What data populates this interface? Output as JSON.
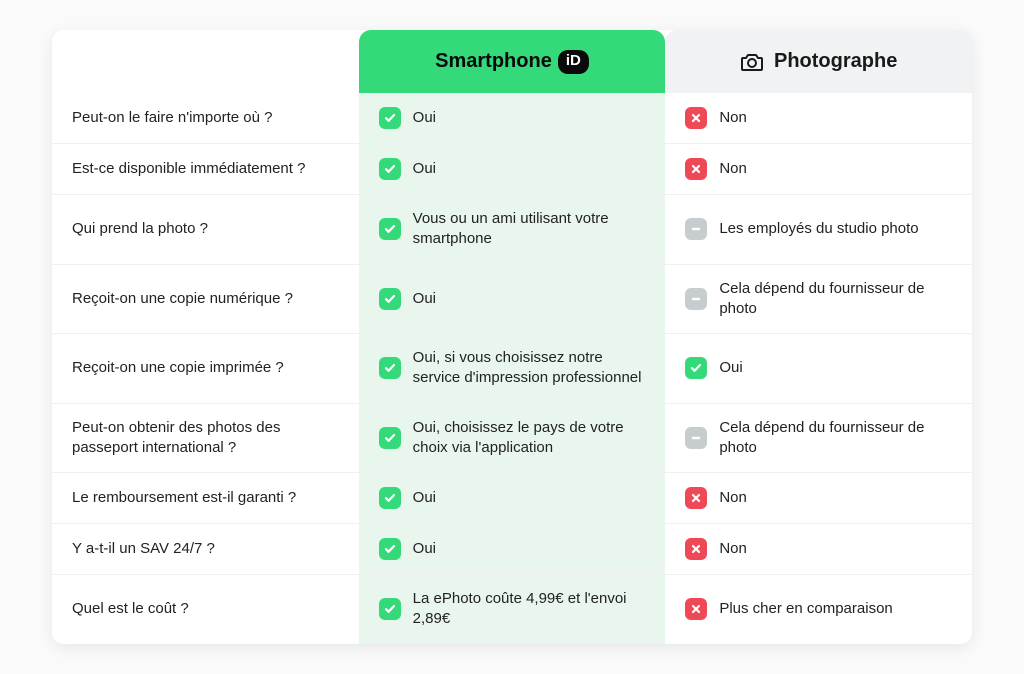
{
  "headers": {
    "brand_text": "Smartphone",
    "brand_badge": "iD",
    "photographer": "Photographe"
  },
  "rows": [
    {
      "q": "Peut-on le faire n'importe où ?",
      "a": {
        "status": "yes",
        "text": "Oui"
      },
      "b": {
        "status": "no",
        "text": "Non"
      }
    },
    {
      "q": "Est-ce disponible immédiatement ?",
      "a": {
        "status": "yes",
        "text": "Oui"
      },
      "b": {
        "status": "no",
        "text": "Non"
      }
    },
    {
      "q": "Qui prend la photo ?",
      "a": {
        "status": "yes",
        "text": "Vous ou un ami utilisant votre smartphone"
      },
      "b": {
        "status": "na",
        "text": "Les employés du studio photo"
      }
    },
    {
      "q": "Reçoit-on une copie numérique ?",
      "a": {
        "status": "yes",
        "text": "Oui"
      },
      "b": {
        "status": "na",
        "text": "Cela dépend du fournisseur de photo"
      }
    },
    {
      "q": "Reçoit-on une copie imprimée ?",
      "a": {
        "status": "yes",
        "text": "Oui, si vous choisissez notre service d'impression professionnel"
      },
      "b": {
        "status": "yes",
        "text": "Oui"
      }
    },
    {
      "q": "Peut-on obtenir des photos des passeport international ?",
      "a": {
        "status": "yes",
        "text": "Oui, choisissez le pays de votre choix via l'application"
      },
      "b": {
        "status": "na",
        "text": "Cela dépend du fournisseur de photo"
      }
    },
    {
      "q": "Le remboursement est-il garanti ?",
      "a": {
        "status": "yes",
        "text": "Oui"
      },
      "b": {
        "status": "no",
        "text": "Non"
      }
    },
    {
      "q": "Y a-t-il un SAV 24/7 ?",
      "a": {
        "status": "yes",
        "text": "Oui"
      },
      "b": {
        "status": "no",
        "text": "Non"
      }
    },
    {
      "q": "Quel est le coût ?",
      "a": {
        "status": "yes",
        "text": "La ePhoto coûte 4,99€ et l'envoi 2,89€"
      },
      "b": {
        "status": "no",
        "text": "Plus cher en comparaison"
      }
    }
  ]
}
